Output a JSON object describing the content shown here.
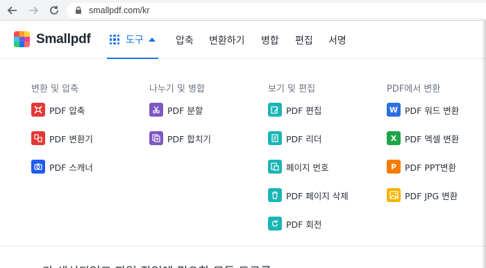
{
  "browser": {
    "url": "smallpdf.com/kr",
    "icons": {
      "back": "back-arrow-icon",
      "forward": "forward-arrow-icon",
      "reload": "reload-icon",
      "lock": "lock-icon"
    }
  },
  "header": {
    "brand": "Smallpdf",
    "brand_colors": [
      "#ff4c4c",
      "#ff9c2a",
      "#ffd23f",
      "#3fc1ff",
      "#6c5ce7",
      "#e84393",
      "#2ecc71",
      "#1a73e8",
      "#ff6b6b"
    ],
    "tools_label": "도구",
    "accent": "#1a73e8",
    "nav": [
      {
        "label": "압축"
      },
      {
        "label": "변환하기"
      },
      {
        "label": "병합"
      },
      {
        "label": "편집"
      },
      {
        "label": "서명"
      }
    ]
  },
  "menu": {
    "columns": [
      {
        "title": "변환 및 압축",
        "items": [
          {
            "label": "PDF 압축",
            "icon": "compress-icon",
            "color": "#e53935"
          },
          {
            "label": "PDF 변환기",
            "icon": "convert-icon",
            "color": "#e53935"
          },
          {
            "label": "PDF 스캐너",
            "icon": "camera-icon",
            "color": "#1e5bf0"
          }
        ]
      },
      {
        "title": "나누기 및 병합",
        "items": [
          {
            "label": "PDF 분할",
            "icon": "scissors-icon",
            "color": "#7e57c2"
          },
          {
            "label": "PDF 합치기",
            "icon": "merge-icon",
            "color": "#7e57c2"
          }
        ]
      },
      {
        "title": "보기 및 편집",
        "items": [
          {
            "label": "PDF 편집",
            "icon": "edit-icon",
            "color": "#1bb5b5"
          },
          {
            "label": "PDF 리더",
            "icon": "reader-icon",
            "color": "#1bb5b5"
          },
          {
            "label": "페이지 번호",
            "icon": "page-number-icon",
            "color": "#1bb5b5"
          },
          {
            "label": "PDF 페이지 삭제",
            "icon": "trash-icon",
            "color": "#1bb5b5"
          },
          {
            "label": "PDF 회전",
            "icon": "rotate-icon",
            "color": "#1bb5b5"
          }
        ]
      },
      {
        "title": "PDF에서 변환",
        "items": [
          {
            "label": "PDF 워드 변환",
            "icon": "word-icon",
            "color": "#2b6fe0",
            "glyph": "W"
          },
          {
            "label": "PDF 엑셀 변환",
            "icon": "excel-icon",
            "color": "#1fa44a",
            "glyph": "X"
          },
          {
            "label": "PDF PPT변환",
            "icon": "ppt-icon",
            "color": "#f57c00",
            "glyph": "P"
          },
          {
            "label": "PDF JPG 변환",
            "icon": "image-icon",
            "color": "#f4b400"
          }
        ]
      }
    ]
  },
  "page": {
    "partial_text": "…가 생성되었고 파일 작업에 필요한 모든 도구를"
  }
}
